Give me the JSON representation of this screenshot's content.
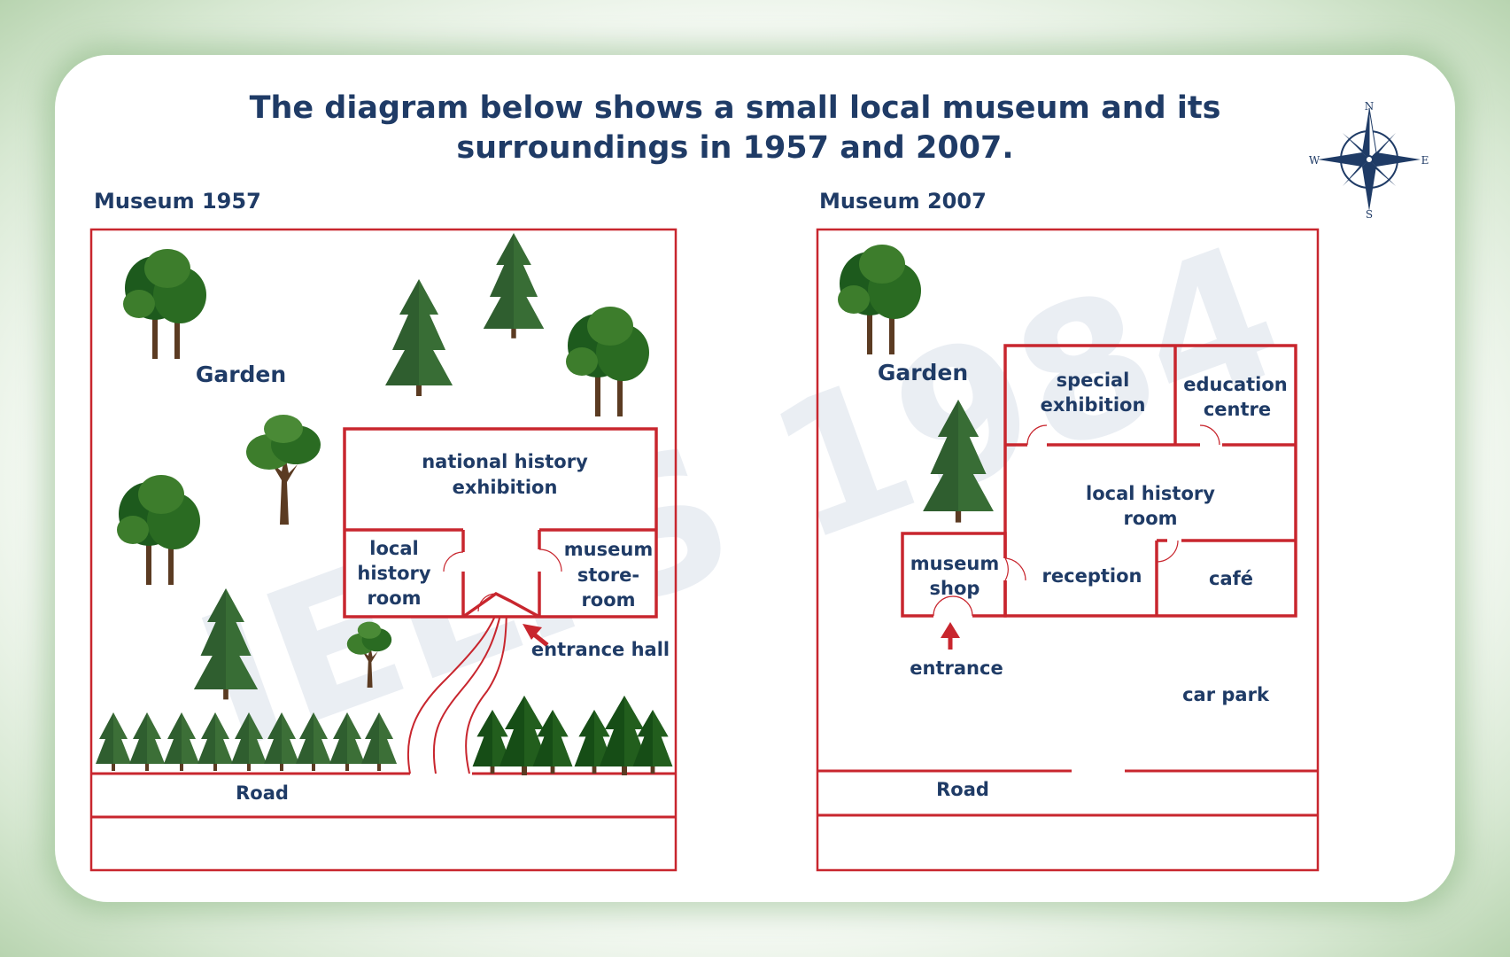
{
  "title": "The diagram below shows a small local museum and its surroundings in 1957 and 2007.",
  "compass": {
    "n": "N",
    "s": "S",
    "e": "E",
    "w": "W"
  },
  "panel_1957": {
    "heading": "Museum 1957",
    "garden": "Garden",
    "national_history_1": "national history",
    "national_history_2": "exhibition",
    "local_history_1": "local",
    "local_history_2": "history",
    "local_history_3": "room",
    "store_1": "museum",
    "store_2": "store-",
    "store_3": "room",
    "entrance_hall": "entrance hall",
    "road": "Road"
  },
  "panel_2007": {
    "heading": "Museum 2007",
    "garden": "Garden",
    "special_1": "special",
    "special_2": "exhibition",
    "education_1": "education",
    "education_2": "centre",
    "local_history_1": "local history",
    "local_history_2": "room",
    "shop_1": "museum",
    "shop_2": "shop",
    "reception": "reception",
    "cafe": "café",
    "entrance": "entrance",
    "car_park": "car park",
    "road": "Road"
  },
  "watermark": "IELTS 1984",
  "colors": {
    "wall": "#c8262e",
    "text": "#1f3b66",
    "tree_dark": "#1d5a1d",
    "tree_light": "#3d7d2c",
    "trunk": "#5b3b22"
  }
}
